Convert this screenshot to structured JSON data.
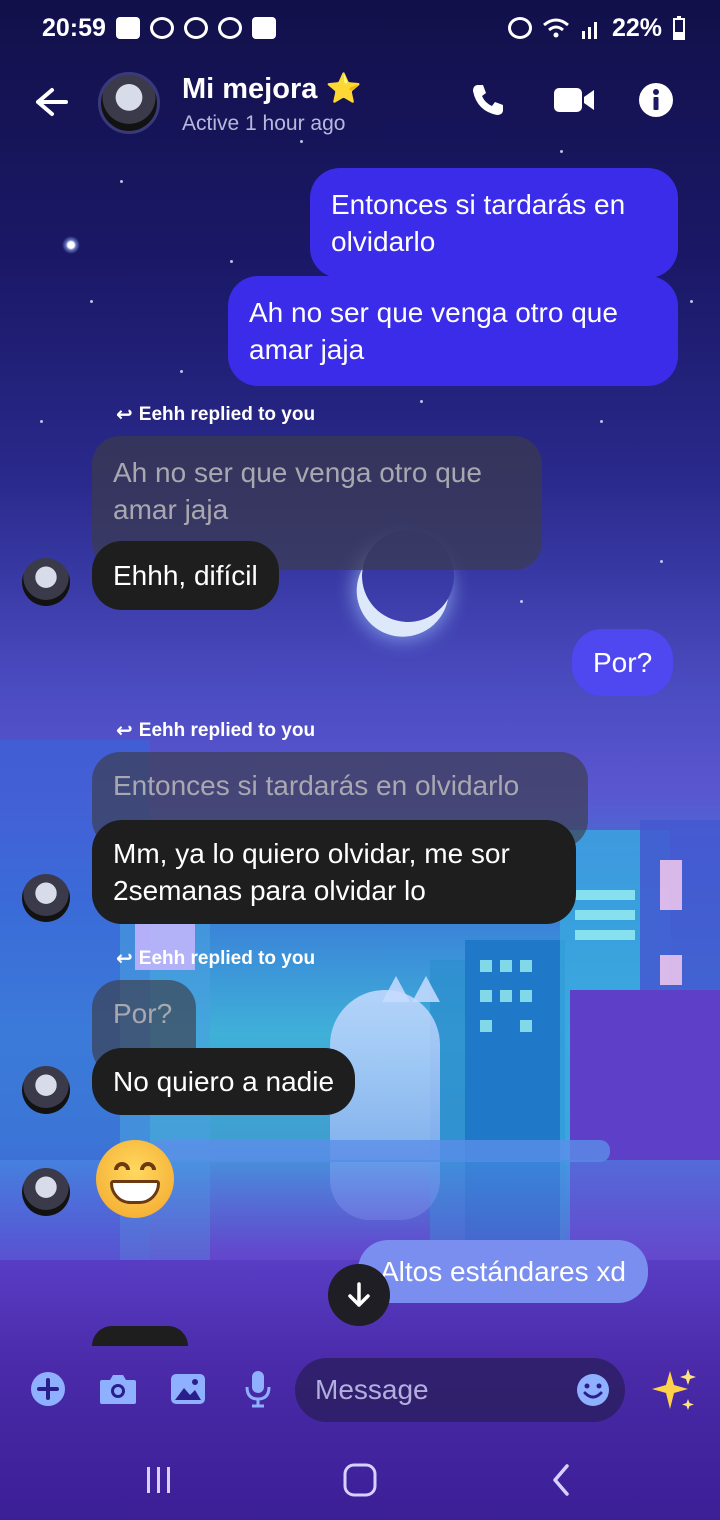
{
  "status_bar": {
    "time": "20:59",
    "battery": "22%",
    "left_icons": [
      "youtube-icon",
      "app-icon",
      "messenger-icon",
      "alarm-icon",
      "gallery-icon"
    ],
    "right_icons": [
      "alarm-icon",
      "wifi-icon",
      "signal-icon",
      "battery-icon"
    ]
  },
  "header": {
    "contact_name": "Mi mejora",
    "name_emoji": "⭐",
    "activity": "Active 1 hour ago",
    "icons": [
      "back-arrow-icon",
      "phone-icon",
      "video-icon",
      "info-icon"
    ]
  },
  "messages": [
    {
      "type": "sent",
      "text": "Entonces si tardarás en olvidarlo"
    },
    {
      "type": "sent",
      "text": "Ah no ser que venga otro que amar jaja"
    },
    {
      "type": "reply",
      "reply_label": "Eehh replied to you",
      "quoted": "Ah no ser que venga otro que amar jaja",
      "text": "Ehhh, difícil"
    },
    {
      "type": "sent",
      "text": "Por?"
    },
    {
      "type": "reply",
      "reply_label": "Eehh replied to you",
      "quoted": "Entonces si tardarás en olvidarlo",
      "text": "Mm, ya lo quiero olvidar, me sor 2semanas para olvidar lo"
    },
    {
      "type": "reply",
      "reply_label": "Eehh replied to you",
      "quoted": "Por?",
      "text": "No quiero a nadie"
    },
    {
      "type": "emoji",
      "text": "😁"
    },
    {
      "type": "sent",
      "text": "Altos estándares xd"
    }
  ],
  "composer": {
    "placeholder": "Message",
    "icons": [
      "plus-icon",
      "camera-icon",
      "image-icon",
      "microphone-icon",
      "emoji-icon",
      "sparkles-icon"
    ]
  },
  "colors": {
    "sent_bubble": "#3a2ce8",
    "received_bubble": "#1e1e1e",
    "accent_icon": "#8fb0ff"
  }
}
